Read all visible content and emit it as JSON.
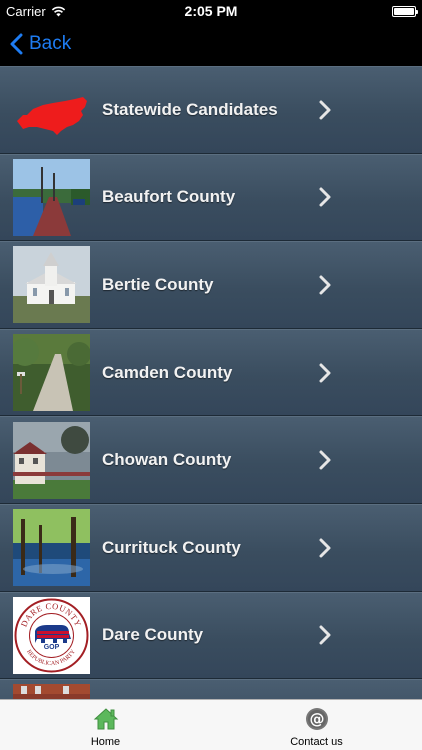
{
  "status_bar": {
    "carrier": "Carrier",
    "time": "2:05 PM",
    "battery_level": 1.0
  },
  "nav": {
    "back_label": "Back"
  },
  "list": {
    "items": [
      {
        "label": "Statewide Candidates",
        "image": "nc-state-map-red"
      },
      {
        "label": "Beaufort County",
        "image": "boardwalk-waterfront-photo"
      },
      {
        "label": "Bertie County",
        "image": "white-church-photo"
      },
      {
        "label": "Camden County",
        "image": "wooden-trail-forest-photo"
      },
      {
        "label": "Chowan County",
        "image": "historic-house-photo"
      },
      {
        "label": "Currituck County",
        "image": "cypress-swamp-photo"
      },
      {
        "label": "Dare County",
        "image": "dare-county-republican-party-logo"
      },
      {
        "label": "",
        "image": "brick-building-photo"
      }
    ]
  },
  "logo": {
    "top_text": "DARE COUNTY",
    "bottom_text": "REPUBLICAN PARTY",
    "letters": "GOP"
  },
  "tabs": [
    {
      "label": "Home",
      "icon": "home-icon",
      "selected": true
    },
    {
      "label": "Contact us",
      "icon": "at-sign-icon",
      "selected": false
    }
  ],
  "colors": {
    "accent": "#1e7cf2",
    "home_icon": "#5cb85c",
    "row_bg": "#3e5163",
    "nc_map": "#ee1c1c"
  }
}
